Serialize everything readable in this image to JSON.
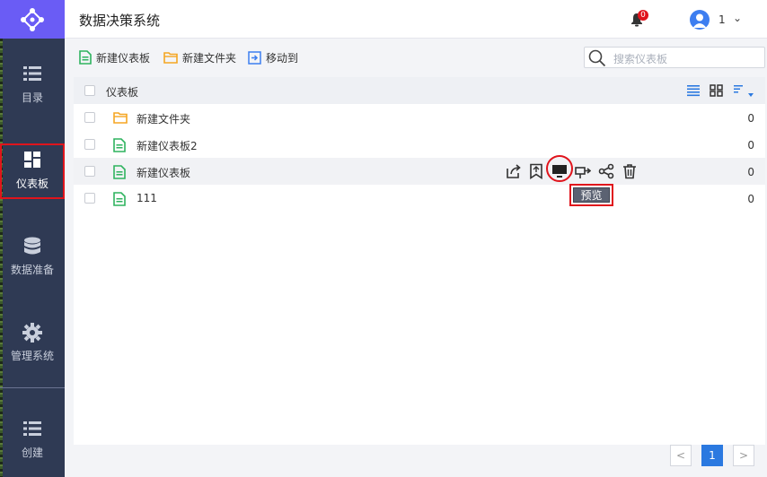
{
  "app": {
    "title": "数据决策系统"
  },
  "header": {
    "notification_count": "0",
    "user_name": "1",
    "caret": "⌄"
  },
  "sidebar": {
    "items": [
      {
        "label": "目录",
        "icon": "list-icon"
      },
      {
        "label": "仪表板",
        "icon": "dashboard-icon",
        "active": true
      },
      {
        "label": "数据准备",
        "icon": "database-icon"
      },
      {
        "label": "管理系统",
        "icon": "gear-icon"
      },
      {
        "label": "创建",
        "icon": "list-icon"
      }
    ]
  },
  "toolbar": {
    "new_dashboard": "新建仪表板",
    "new_folder": "新建文件夹",
    "move_to": "移动到",
    "search_placeholder": "搜索仪表板"
  },
  "table": {
    "header_label": "仪表板",
    "rows": [
      {
        "name": "新建文件夹",
        "type": "folder",
        "count": "0"
      },
      {
        "name": "新建仪表板2",
        "type": "dashboard",
        "count": "0"
      },
      {
        "name": "新建仪表板",
        "type": "dashboard",
        "count": "0"
      },
      {
        "name": "111",
        "type": "dashboard",
        "count": "0"
      }
    ]
  },
  "tooltip": {
    "preview": "预览"
  },
  "pagination": {
    "prev": "<",
    "current": "1",
    "next": ">"
  },
  "colors": {
    "sidebar_bg": "#2f3a54",
    "logo_bg": "#6a5cf5",
    "accent_blue": "#2b79e0",
    "highlight_red": "#e0141c",
    "folder": "#f5a623",
    "dashboard": "#2fb35f"
  }
}
